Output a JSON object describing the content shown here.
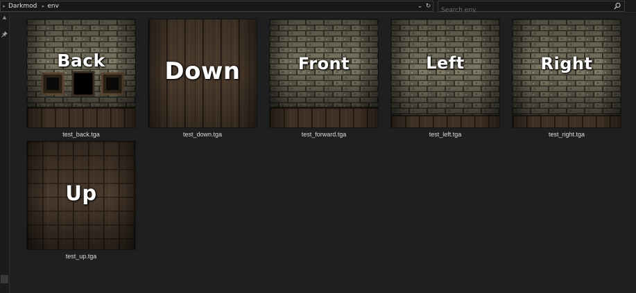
{
  "breadcrumb": {
    "items": [
      "Darkmod",
      "env"
    ]
  },
  "address_controls": {
    "dropdown_glyph": "⌄",
    "refresh_glyph": "↻"
  },
  "search": {
    "placeholder": "Search env"
  },
  "icons": [
    "chevron-right-icon",
    "chevron-down-icon",
    "refresh-icon",
    "search-icon",
    "pin-icon"
  ],
  "files": [
    {
      "name": "test_back.tga",
      "label": "Back",
      "kind": "wall-window"
    },
    {
      "name": "test_down.tga",
      "label": "Down",
      "kind": "planks"
    },
    {
      "name": "test_forward.tga",
      "label": "Front",
      "kind": "wall"
    },
    {
      "name": "test_left.tga",
      "label": "Left",
      "kind": "wall"
    },
    {
      "name": "test_right.tga",
      "label": "Right",
      "kind": "wall"
    },
    {
      "name": "test_up.tga",
      "label": "Up",
      "kind": "ceiling"
    }
  ],
  "colors": {
    "background": "#1f1f1f",
    "stone": "#7c7866",
    "wood": "#4a3a2c"
  }
}
